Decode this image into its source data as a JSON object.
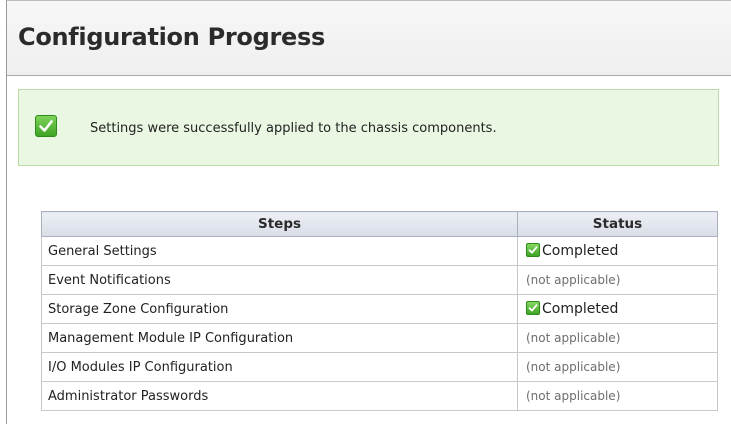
{
  "page": {
    "title": "Configuration Progress"
  },
  "message": {
    "text": "Settings were successfully applied to the chassis components.",
    "icon": "success-check-icon"
  },
  "table": {
    "columns": [
      "Steps",
      "Status"
    ],
    "rows": [
      {
        "step": "General Settings",
        "status": "Completed",
        "completed": true
      },
      {
        "step": "Event Notifications",
        "status": "(not applicable)",
        "completed": false
      },
      {
        "step": "Storage Zone Configuration",
        "status": "Completed",
        "completed": true
      },
      {
        "step": "Management Module IP Configuration",
        "status": "(not applicable)",
        "completed": false
      },
      {
        "step": "I/O Modules IP Configuration",
        "status": "(not applicable)",
        "completed": false
      },
      {
        "step": "Administrator Passwords",
        "status": "(not applicable)",
        "completed": false
      }
    ]
  },
  "colors": {
    "success_bg": "#eaf7e2",
    "success_border": "#b9dca6",
    "check_green": "#3ea324"
  }
}
